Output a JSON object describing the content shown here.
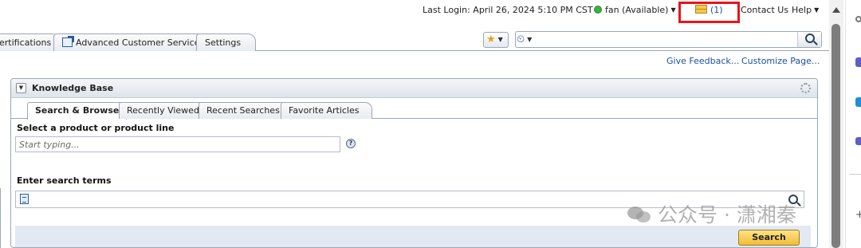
{
  "topbar": {
    "last_login": "Last Login: April 26, 2024 5:10 PM CST",
    "user_status": "fan (Available)",
    "messages_count": "(1)",
    "contact_us": "Contact Us",
    "help": "Help"
  },
  "nav_tabs": [
    {
      "label": "ertifications"
    },
    {
      "label": "Advanced Customer Services"
    },
    {
      "label": "Settings"
    }
  ],
  "page_links": {
    "give_feedback": "Give Feedback...",
    "customize_page": "Customize Page..."
  },
  "knowledge_base": {
    "title": "Knowledge Base",
    "tabs": [
      {
        "label": "Search & Browse",
        "active": true
      },
      {
        "label": "Recently Viewed",
        "active": false
      },
      {
        "label": "Recent Searches",
        "active": false
      },
      {
        "label": "Favorite Articles",
        "active": false
      }
    ],
    "product_label": "Select a product or product line",
    "product_placeholder": "Start typing...",
    "terms_label": "Enter search terms",
    "search_button": "Search"
  },
  "watermark": "公众号 · 潇湘秦",
  "colors": {
    "highlight_box": "#e8141b",
    "link": "#1a4f9c",
    "search_button": "#f2bd35",
    "status_available": "#3cb043"
  },
  "icons": [
    "status-available-icon",
    "envelope-icon",
    "favorites-star-icon",
    "history-icon",
    "search-icon",
    "collapse-icon",
    "gear-icon",
    "help-icon",
    "document-icon"
  ]
}
